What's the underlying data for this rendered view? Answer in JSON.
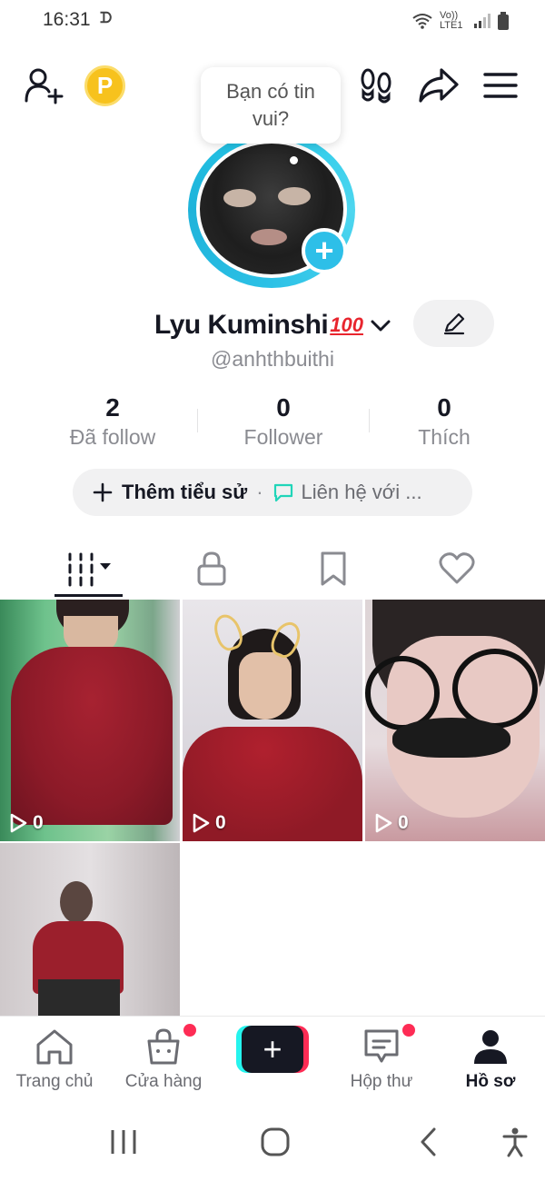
{
  "status_bar": {
    "time": "16:31",
    "extra_icon": "ᗪ",
    "network": "Vo)) LTE1"
  },
  "top_bar": {
    "add_friend_icon": "person-plus-icon",
    "coin_label": "P",
    "footprints_icon": "footprints-icon",
    "share_icon": "share-arrow-icon",
    "menu_icon": "hamburger-menu-icon"
  },
  "bubble": {
    "line1": "Bạn có tin",
    "line2": "vui?"
  },
  "profile": {
    "name": "Lyu Kuminshi",
    "name_emoji": "100",
    "handle": "@anhthbuithi"
  },
  "stats": [
    {
      "value": "2",
      "label": "Đã follow"
    },
    {
      "value": "0",
      "label": "Follower"
    },
    {
      "value": "0",
      "label": "Thích"
    }
  ],
  "bio": {
    "add_label": "Thêm tiểu sử",
    "separator": "·",
    "contact_label": "Liên hệ với ..."
  },
  "tabs": [
    {
      "name": "videos",
      "icon": "grid-bars-icon",
      "active": true
    },
    {
      "name": "private",
      "icon": "lock-icon",
      "active": false
    },
    {
      "name": "saved",
      "icon": "bookmark-icon",
      "active": false
    },
    {
      "name": "liked",
      "icon": "heart-icon",
      "active": false
    }
  ],
  "videos": [
    {
      "views": "0"
    },
    {
      "views": "0"
    },
    {
      "views": "0"
    },
    {
      "views": ""
    }
  ],
  "bottom_nav": [
    {
      "label": "Trang chủ",
      "icon": "home-icon",
      "badge": false
    },
    {
      "label": "Cửa hàng",
      "icon": "shopping-bag-icon",
      "badge": true
    },
    {
      "label": "",
      "icon": "create-plus-icon",
      "badge": false
    },
    {
      "label": "Hộp thư",
      "icon": "inbox-icon",
      "badge": true
    },
    {
      "label": "Hồ sơ",
      "icon": "profile-icon",
      "badge": false,
      "active": true
    }
  ],
  "colors": {
    "accent_cyan": "#25f4ee",
    "accent_red": "#fe2c55",
    "avatar_ring": "#2dbfe8",
    "text_primary": "#161823",
    "text_secondary": "#8a8b91"
  }
}
